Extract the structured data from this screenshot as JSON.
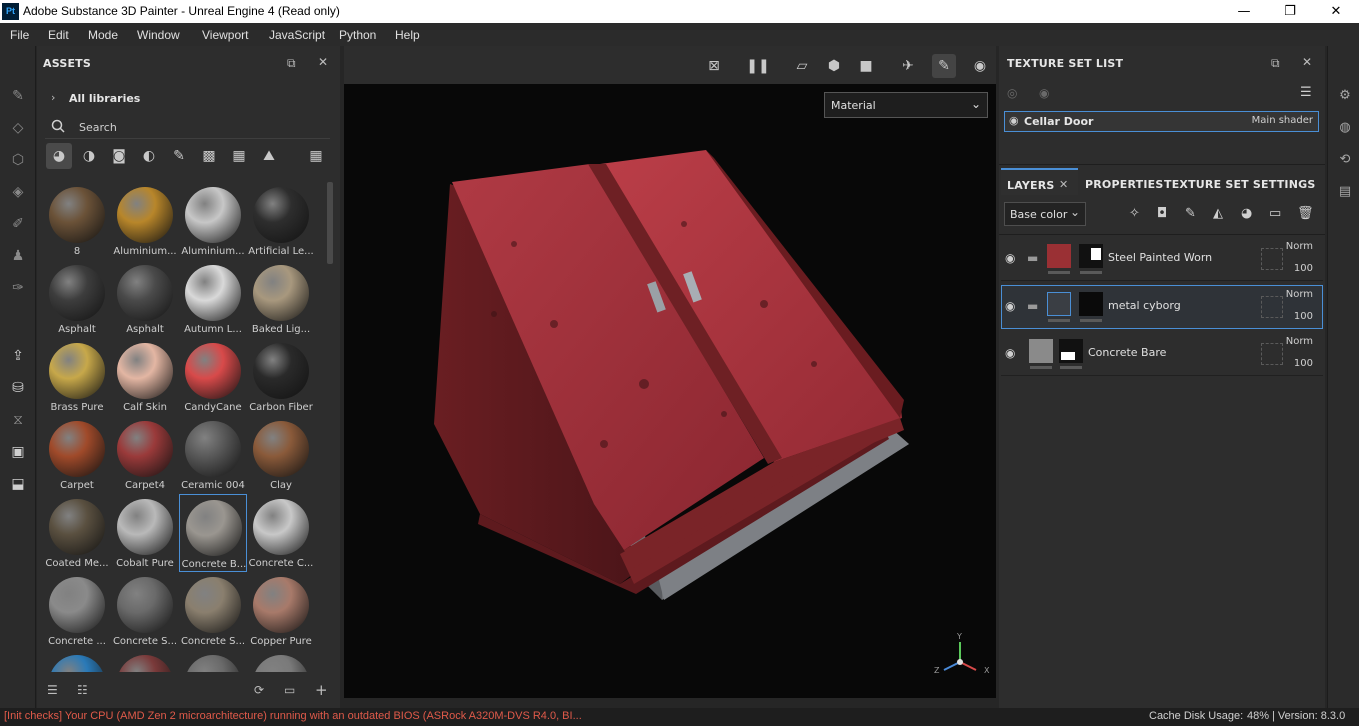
{
  "window": {
    "app_icon": "Pt",
    "title": "Adobe Substance 3D Painter - Unreal Engine 4 (Read only)",
    "minimize": "—",
    "maximize": "❐",
    "close": "✕"
  },
  "menu": [
    "File",
    "Edit",
    "Mode",
    "Window",
    "Viewport",
    "JavaScript",
    "Python",
    "Help"
  ],
  "assets": {
    "title": "ASSETS",
    "library": "All libraries",
    "search_placeholder": "Search",
    "items": [
      {
        "label": "8",
        "color": "#6b5238"
      },
      {
        "label": "Aluminium...",
        "color": "#b8862a"
      },
      {
        "label": "Aluminium...",
        "color": "#c7c7c7"
      },
      {
        "label": "Artificial Le...",
        "color": "#2e2e2e"
      },
      {
        "label": "Asphalt",
        "color": "#3d3d3d"
      },
      {
        "label": "Asphalt",
        "color": "#4a4a4a"
      },
      {
        "label": "Autumn L...",
        "color": "#d9d9d9"
      },
      {
        "label": "Baked Lig...",
        "color": "#a8987e"
      },
      {
        "label": "Brass Pure",
        "color": "#c7a84a"
      },
      {
        "label": "Calf Skin",
        "color": "#e3b6a3"
      },
      {
        "label": "CandyCane",
        "color": "#d84a4a"
      },
      {
        "label": "Carbon Fiber",
        "color": "#2a2a2a"
      },
      {
        "label": "Carpet",
        "color": "#a04a2a"
      },
      {
        "label": "Carpet4",
        "color": "#9a3a3a"
      },
      {
        "label": "Ceramic 004",
        "color": "#5a5a5a"
      },
      {
        "label": "Clay",
        "color": "#8a5a3a"
      },
      {
        "label": "Coated Me...",
        "color": "#5a5040"
      },
      {
        "label": "Cobalt Pure",
        "color": "#b9b9b9"
      },
      {
        "label": "Concrete B...",
        "color": "#9a9690"
      },
      {
        "label": "Concrete C...",
        "color": "#c8c8c8"
      },
      {
        "label": "Concrete ...",
        "color": "#8a8a8a"
      },
      {
        "label": "Concrete S...",
        "color": "#6a6a6a"
      },
      {
        "label": "Concrete S...",
        "color": "#8a7f6e"
      },
      {
        "label": "Copper Pure",
        "color": "#a87a6a"
      },
      {
        "label": "",
        "color": "#2a7ab8"
      },
      {
        "label": "",
        "color": "#7a3a3a"
      },
      {
        "label": "",
        "color": "#6a6a6a"
      },
      {
        "label": "",
        "color": "#7a7a7a"
      }
    ]
  },
  "viewport": {
    "channel": "Material",
    "axis_x": "X",
    "axis_y": "Y",
    "axis_z": "Z"
  },
  "texture_set": {
    "title": "TEXTURE SET LIST",
    "name": "Cellar Door",
    "shader": "Main shader"
  },
  "layers_panel": {
    "tabs": [
      "LAYERS",
      "PROPERTIES",
      "TEXTURE SET SETTINGS"
    ],
    "channel": "Base color",
    "layers": [
      {
        "name": "Steel Painted Worn",
        "blend": "Norm",
        "opacity": "100"
      },
      {
        "name": "metal cyborg",
        "blend": "Norm",
        "opacity": "100"
      },
      {
        "name": "Concrete Bare",
        "blend": "Norm",
        "opacity": "100"
      }
    ]
  },
  "status": {
    "message": "[Init checks] Your CPU (AMD Zen 2 microarchitecture) running with an outdated BIOS (ASRock A320M-DVS R4.0, BI...",
    "message_color": "#e05a4a",
    "cache": "Cache Disk Usage:",
    "percent": "48%",
    "version": "| Version: 8.3.0"
  }
}
